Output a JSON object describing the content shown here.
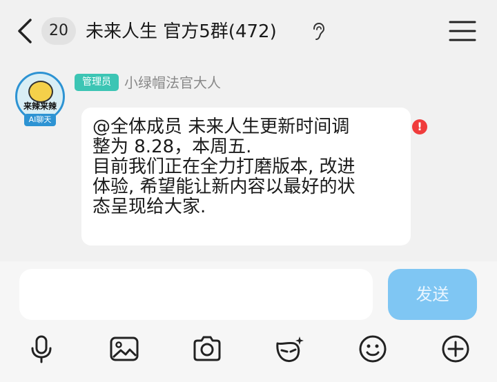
{
  "header": {
    "unread_count": "20",
    "title": "未来人生 官方5群(472)",
    "icons": [
      "back-arrow-icon",
      "ear-icon",
      "hamburger-menu-icon"
    ]
  },
  "message": {
    "avatar_text": "来辣来辣",
    "avatar_badge": "AI聊天",
    "role_badge": "管理员",
    "sender": "小绿帽法官大人",
    "text": "@全体成员 未来人生更新时间调\n整为 8.28，本周五.\n目前我们正在全力打磨版本, 改进\n体验, 希望能让新内容以最好的状\n态呈现给大家.",
    "status_icon": "!"
  },
  "composer": {
    "input_value": "",
    "send_label": "发送",
    "tools": [
      "microphone-icon",
      "image-icon",
      "camera-icon",
      "mask-icon",
      "emoji-icon",
      "plus-icon"
    ]
  },
  "colors": {
    "accent": "#2d93d3",
    "role_badge_bg": "#3cc5b4",
    "send_button": "#7fc6f3",
    "error": "#f03c3c"
  }
}
